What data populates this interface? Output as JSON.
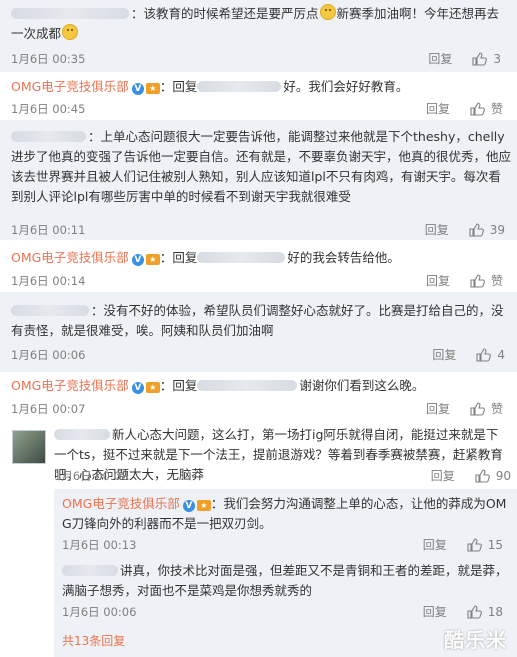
{
  "comments": [
    {
      "text": "：该教育的时候希望还是要严厉点",
      "text2": "新赛季加油啊！今年还想再去一次成都",
      "time": "1月6日 00:35",
      "reply": "回复",
      "likes": "3"
    },
    {
      "user": "OMG电子竞技俱乐部",
      "text_prefix": "：回复",
      "text": "好。我们会好好教育。",
      "time": "1月6日 00:45",
      "reply": "回复",
      "likes": "赞"
    },
    {
      "text": "：上单心态问题很大一定要告诉他，能调整过来他就是下个theshy，chelly进步了他真的变强了告诉他一定要自信。还有就是，不要辜负谢天宇，他真的很优秀，他应该去世界赛并且被人们记住被别人熟知，别人应该知道lpl不只有肉鸡，有谢天宇。每次看到别人评论lpl有哪些厉害中单的时候看不到谢天宇我就很难受",
      "time": "1月6日 00:11",
      "reply": "回复",
      "likes": "39"
    },
    {
      "user": "OMG电子竞技俱乐部",
      "text_prefix": "：回复",
      "text": "好的我会转告给他。",
      "time": "1月6日 00:14",
      "reply": "回复",
      "likes": "赞"
    },
    {
      "text": "：没有不好的体验，希望队员们调整好心态就好了。比赛是打给自己的，没有责怪，就是很难受，唉。阿姨和队员们加油啊",
      "time": "1月6日 00:06",
      "reply": "回复",
      "likes": "4"
    },
    {
      "user": "OMG电子竞技俱乐部",
      "text_prefix": "：回复",
      "text": "谢谢你们看到这么晚。",
      "time": "1月6日 00:07",
      "reply": "回复",
      "likes": "赞"
    },
    {
      "text": "新人心态大问题，这么打，第一场打ig阿乐就得自闭，能挺过来就是下一个ts，挺不过来就是下一个法王，提前退游戏？等着到春季赛被禁赛，赶紧教育吧，心态问题太大，无脑莽",
      "time": "1月6日 00:08",
      "reply": "回复",
      "likes": "90"
    },
    {
      "user": "OMG电子竞技俱乐部",
      "text": "：我们会努力沟通调整上单的心态，让他的莽成为OMG刀锋向外的利器而不是一把双刃剑。",
      "time": "1月6日 00:13",
      "reply": "回复",
      "likes": "15"
    },
    {
      "text": "讲真，你技术比对面是强，但差距又不是青铜和王者的差距，就是莽，满脑子想秀，对面也不是菜鸡是你想秀就秀的",
      "time": "1月6日 00:06",
      "reply": "回复",
      "likes": "18"
    }
  ],
  "footer": {
    "more": "共13条回复"
  },
  "watermark": "酷乐米",
  "colors": {
    "username": "#eb7350",
    "meta": "#808080",
    "band": "#eef1f5"
  }
}
